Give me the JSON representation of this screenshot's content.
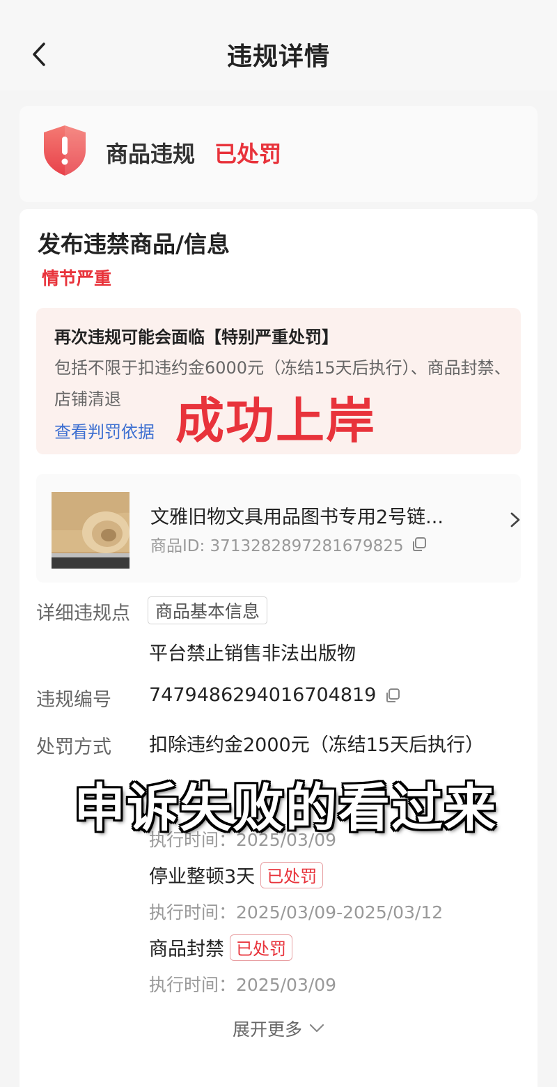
{
  "nav": {
    "title": "违规详情"
  },
  "status": {
    "type_label": "商品违规",
    "badge": "已处罚"
  },
  "violation": {
    "title": "发布违禁商品/信息",
    "severity": "情节严重"
  },
  "warning": {
    "title": "再次违规可能会面临【特别严重处罚】",
    "body": "包括不限于扣违约金6000元（冻结15天后执行）、商品封禁、店铺清退",
    "link": "查看判罚依据"
  },
  "overlay_top": "成功上岸",
  "product": {
    "name": "文雅旧物文具用品图书专用2号链...",
    "id_label": "商品ID: 3713282897281679825"
  },
  "details": {
    "violation_point_label": "详细违规点",
    "violation_point_tag": "商品基本信息",
    "violation_point_text": "平台禁止销售非法出版物",
    "number_label": "违规编号",
    "number_value": "7479486294016704819",
    "penalty_label": "处罚方式",
    "penalties": [
      {
        "text": "扣除违约金2000元（冻结15天后执行）",
        "time": "执行时间：2025/03/09"
      },
      {
        "text": "停业整顿3天",
        "badge": "已处罚",
        "time": "执行时间：2025/03/09-2025/03/12"
      },
      {
        "text": "商品封禁",
        "badge": "已处罚",
        "time": "执行时间：2025/03/09"
      }
    ]
  },
  "overlay_bottom": "申诉失败的看过来",
  "expand_label": "展开更多",
  "colors": {
    "accent_red": "#e8333b",
    "link_blue": "#3d6fd1"
  }
}
